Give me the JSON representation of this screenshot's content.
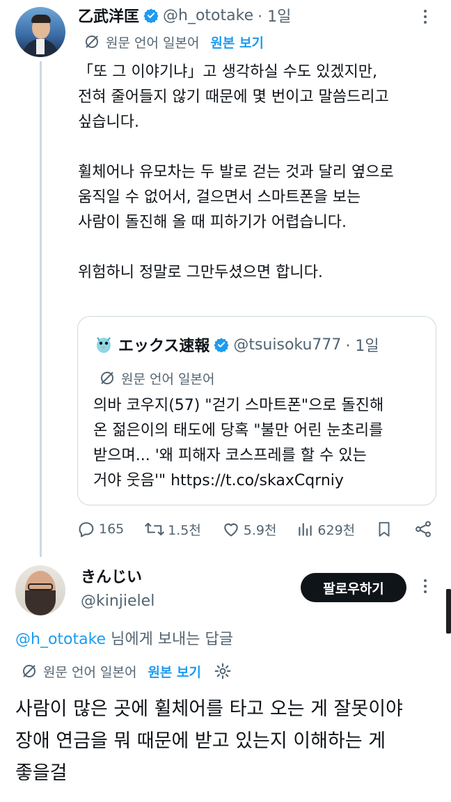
{
  "tweet": {
    "author_name": "乙武洋匡",
    "author_handle": "@h_ototake",
    "time": "· 1일",
    "translate_label": "원문 언어 일본어",
    "show_original": "원본 보기",
    "lines": [
      "「또 그 이야기냐」고 생각하실 수도 있겠지만,",
      "전혀 줄어들지 않기 때문에 몇 번이고 말씀드리고",
      "싶습니다.",
      "",
      "휠체어나 유모차는 두 발로 걷는 것과 달리 옆으로",
      "움직일 수 없어서, 걸으면서 스마트폰을 보는",
      "사람이 돌진해 올 때 피하기가 어렵습니다.",
      "",
      "위험하니 정말로 그만두셨으면 합니다."
    ]
  },
  "quote": {
    "author_name": "エックス速報",
    "author_handle": "@tsuisoku777",
    "time": "· 1일",
    "translate_label": "원문 언어 일본어",
    "lines": [
      "의바 코우지(57) \"걷기 스마트폰\"으로 돌진해",
      "온 젊은이의 태도에 당혹 \"불만 어린 눈초리를",
      "받으며... '왜 피해자 코스프레를 할 수 있는",
      "거야 웃음'\" https://t.co/skaxCqrniy"
    ]
  },
  "actions": {
    "replies": "165",
    "reposts": "1.5천",
    "likes": "5.9천",
    "views": "629천"
  },
  "reply": {
    "author_name": "きんじい",
    "author_handle": "@kinjielel",
    "follow_label": "팔로우하기",
    "replying_to_handle": "@h_ototake",
    "replying_to_suffix": " 님에게 보내는 답글",
    "translate_label": "원문 언어 일본어",
    "show_original": "원본 보기",
    "lines": [
      "사람이 많은 곳에 휠체어를 타고 오는 게 잘못이야",
      "장애 연금을 뭐 때문에 받고 있는지 이해하는 게",
      "좋을걸"
    ]
  },
  "colors": {
    "accent": "#1d9bf0",
    "secondary_text": "#536471",
    "follow_button": "#0f1419"
  }
}
